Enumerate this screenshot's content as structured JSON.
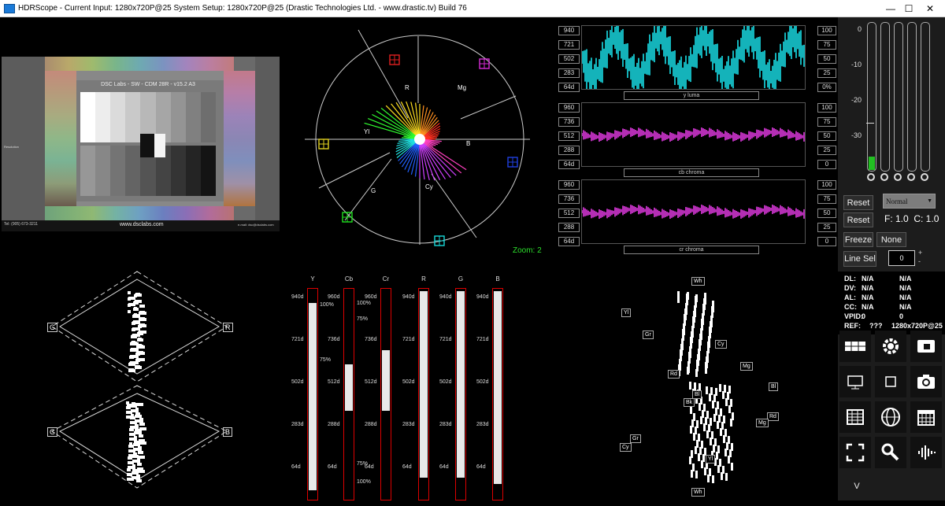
{
  "window": {
    "title": "HDRScope -  Current Input: 1280x720P@25   System Setup: 1280x720P@25    (Drastic Technologies Ltd. - www.drastic.tv) Build 76",
    "minimize": "—",
    "maximize": "☐",
    "close": "✕"
  },
  "chart_panel": {
    "header": "DSC Labs - SW - CDM 28R - v15.2 A3",
    "footer": "www.dsclabs.com",
    "phone": "Tel: (905) 673-3211",
    "email": "e-mail: dsc@dsclabs.com",
    "left_note": "Resolution",
    "grey_levels": [
      1,
      0.93,
      0.86,
      0.79,
      0.72,
      0.65,
      0.58,
      0.5,
      0.43
    ]
  },
  "vectorscope": {
    "labels": [
      "R",
      "Mg",
      "B",
      "Cy",
      "G",
      "Yl"
    ],
    "zoom": "Zoom: 2"
  },
  "waveforms": [
    {
      "name": "y luma",
      "left_ticks": [
        "940",
        "721",
        "502",
        "283",
        "64d"
      ],
      "right_ticks": [
        "100",
        "75",
        "50",
        "25",
        "0%"
      ],
      "color": "#19e0e8"
    },
    {
      "name": "cb chroma",
      "left_ticks": [
        "960",
        "736",
        "512",
        "288",
        "64d"
      ],
      "right_ticks": [
        "100",
        "75",
        "50",
        "25",
        "0"
      ],
      "color": "#e23ae2"
    },
    {
      "name": "cr chroma",
      "left_ticks": [
        "960",
        "736",
        "512",
        "288",
        "64d"
      ],
      "right_ticks": [
        "100",
        "75",
        "50",
        "25",
        "0"
      ],
      "color": "#e23ae2"
    }
  ],
  "bars": {
    "headers": [
      "Y",
      "Cb",
      "Cr",
      "R",
      "G",
      "B"
    ],
    "ticks_y": [
      "940d",
      "721d",
      "502d",
      "283d",
      "64d"
    ],
    "ticks_c": [
      "960d",
      "736d",
      "512d",
      "288d",
      "64d"
    ],
    "pct_y": [
      "100%",
      "75%"
    ],
    "pct_c": [
      "100%",
      "75%",
      "75%",
      "100%"
    ],
    "fill_top": [
      0.06,
      0.36,
      0.29,
      0.0,
      0.0,
      0.0
    ],
    "fill_bottom": [
      0.98,
      0.59,
      0.59,
      0.92,
      0.92,
      0.95
    ]
  },
  "rgb_diamond": {
    "labels": [
      "G",
      "R",
      "G",
      "B"
    ]
  },
  "gamut": {
    "labels": [
      "Wh",
      "Yl",
      "Gr",
      "Cy",
      "Mg",
      "Rd",
      "Bl",
      "Bk",
      "Bl",
      "Rd",
      "Mg",
      "Gr",
      "Cy",
      "Yl",
      "Wh"
    ]
  },
  "audio": {
    "scale": [
      "0",
      "-10",
      "-20",
      "-30"
    ],
    "levels": [
      0.09,
      0.0,
      0.0,
      0.0,
      0.0
    ]
  },
  "controls": {
    "reset1": "Reset",
    "mode": "Normal",
    "reset2": "Reset",
    "fc": "F: 1.0  C: 1.0",
    "freeze": "Freeze",
    "none": "None",
    "linesel": "Line Sel",
    "line_value": "0"
  },
  "status": {
    "rows": [
      {
        "k": "DL:",
        "a": "N/A",
        "b": "N/A"
      },
      {
        "k": "DV:",
        "a": "N/A",
        "b": "N/A"
      },
      {
        "k": "AL:",
        "a": "N/A",
        "b": "N/A"
      },
      {
        "k": "CC:",
        "a": "N/A",
        "b": "N/A"
      },
      {
        "k": "VPID:",
        "a": "0",
        "b": "0"
      },
      {
        "k": "REF:",
        "a": "???",
        "b": "1280x720P@25"
      }
    ]
  },
  "tiles": [
    "grid-icon",
    "gear-icon",
    "video-cast-icon",
    "monitor-icon",
    "square-icon",
    "camera-icon",
    "table-icon",
    "globe-icon",
    "calendar-icon",
    "fullscreen-icon",
    "search-icon",
    "audio-wave-icon"
  ],
  "bottom_button": "V"
}
